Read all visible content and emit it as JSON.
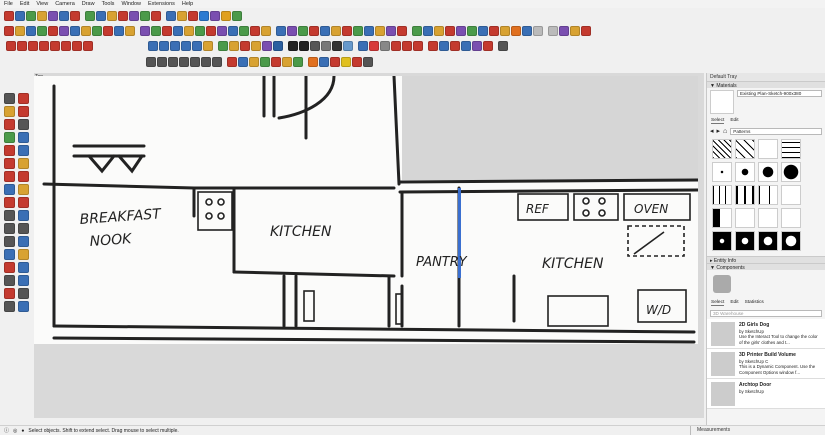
{
  "menu": [
    "File",
    "Edit",
    "View",
    "Camera",
    "Draw",
    "Tools",
    "Window",
    "Extensions",
    "Help"
  ],
  "toolbar_colors": {
    "row1": [
      "#c43a2f",
      "#3a6fb5",
      "#4b9a4a",
      "#d8a232",
      "#7a4fb0",
      "#3a6fb5",
      "#c43a2f",
      "#4b9a4a",
      "#3a6fb5",
      "#d8a232",
      "#c43a2f",
      "#7a4fb0",
      "#4b9a4a",
      "#c43a2f",
      "#3a6fb5",
      "#d8a232",
      "#c43a2f",
      "#2b7bd1",
      "#7a4fb0",
      "#e0a020",
      "#4b9a4a"
    ],
    "row2": [
      "#c43a2f",
      "#d8a232",
      "#3a6fb5",
      "#4b9a4a",
      "#c43a2f",
      "#7a4fb0",
      "#3a6fb5",
      "#d8a232",
      "#4b9a4a",
      "#c43a2f",
      "#3a6fb5",
      "#d8a232",
      "#7a4fb0",
      "#4b9a4a",
      "#c43a2f",
      "#3a6fb5",
      "#d8a232",
      "#4b9a4a",
      "#c43a2f",
      "#7a4fb0",
      "#3a6fb5",
      "#4b9a4a",
      "#c43a2f",
      "#d8a232",
      "#3a6fb5",
      "#7a4fb0",
      "#4b9a4a",
      "#c43a2f",
      "#3a6fb5",
      "#d8a232",
      "#c43a2f",
      "#4b9a4a",
      "#3a6fb5",
      "#d8a232",
      "#7a4fb0",
      "#c43a2f",
      "#4b9a4a",
      "#3a6fb5",
      "#d8a232",
      "#c43a2f",
      "#7a4fb0",
      "#4b9a4a",
      "#3a6fb5",
      "#c43a2f",
      "#d8a232",
      "#e07020",
      "#3a6fb5",
      "#bbbbbb",
      "#bbbbbb",
      "#7a4fb0",
      "#d8a232",
      "#c43a2f"
    ],
    "row3a": [
      "#c43a2f",
      "#c43a2f",
      "#c43a2f",
      "#c43a2f",
      "#c43a2f",
      "#c43a2f",
      "#c43a2f",
      "#c43a2f"
    ],
    "row3b": [
      "#3a6fb5",
      "#3a6fb5",
      "#3a6fb5",
      "#3a6fb5",
      "#3a6fb5",
      "#d8a232",
      "#4b9a4a",
      "#d8a232",
      "#c43a2f",
      "#d8a232",
      "#7a4fb0",
      "#2b5fa0",
      "#222222",
      "#222222",
      "#555555",
      "#777777",
      "#333333",
      "#6699cc",
      "#3a6fb5",
      "#d83a3a",
      "#888888",
      "#c43a2f",
      "#c43a2f",
      "#c43a2f",
      "#c43a2f",
      "#3a6fb5",
      "#c43a2f",
      "#3a6fb5",
      "#7a4fb0",
      "#c43a2f",
      "#555555"
    ],
    "row4": [
      "#555555",
      "#555555",
      "#555555",
      "#555555",
      "#555555",
      "#555555",
      "#555555",
      "#c43a2f",
      "#3a6fb5",
      "#d8a232",
      "#4b9a4a",
      "#c43a2f",
      "#d8a232",
      "#4b9a4a",
      "#e07020",
      "#3a6fb5",
      "#c43a2f",
      "#e0c020",
      "#c43a2f",
      "#555555"
    ],
    "left": [
      "#555555",
      "#c43a2f",
      "#d8a232",
      "#c43a2f",
      "#c43a2f",
      "#555555",
      "#4b9a4a",
      "#3a6fb5",
      "#c43a2f",
      "#3a6fb5",
      "#c43a2f",
      "#d8a232",
      "#c43a2f",
      "#c43a2f",
      "#3a6fb5",
      "#d8a232",
      "#c43a2f",
      "#c43a2f",
      "#555555",
      "#3a6fb5",
      "#555555",
      "#555555",
      "#555555",
      "#3a6fb5",
      "#3a6fb5",
      "#d8a232",
      "#c43a2f",
      "#3a6fb5",
      "#555555",
      "#3a6fb5",
      "#c43a2f",
      "#555555",
      "#555555",
      "#3a6fb5"
    ]
  },
  "scene": {
    "label": "Top"
  },
  "sketch": {
    "labels": {
      "breakfast_1": "BREAKFAST",
      "breakfast_2": "NOOK",
      "kitchen_1": "KITCHEN",
      "pantry": "PANTRY",
      "kitchen_2": "KITCHEN",
      "ref": "REF",
      "oven": "OVEN",
      "wd": "W/D"
    }
  },
  "tray": {
    "title": "Default Tray",
    "materials": {
      "header": "▼ Materials",
      "name_value": "Existing Plan-Sketch-900x380",
      "tabs": [
        "Select",
        "Edit"
      ],
      "library": "Patterns"
    },
    "entity_info": {
      "header": "▸ Entity Info"
    },
    "components": {
      "header": "▼ Components",
      "tabs": [
        "Select",
        "Edit",
        "Statistics"
      ],
      "search_placeholder": "3D Warehouse",
      "items": [
        {
          "title": "2D Girls Dog",
          "by": "by SketchUp",
          "desc": "Use the Interact Tool to change the color of the girls' clothes and t..."
        },
        {
          "title": "3D Printer Build Volume",
          "by": "by SketchUp C",
          "desc": "This is a Dynamic Component. Use the Component Options window f..."
        },
        {
          "title": "Archtop Door",
          "by": "by SketchUp",
          "desc": ""
        }
      ]
    }
  },
  "status": {
    "message": "Select objects. Shift to extend select. Drag mouse to select multiple.",
    "measurements_label": "Measurements"
  }
}
